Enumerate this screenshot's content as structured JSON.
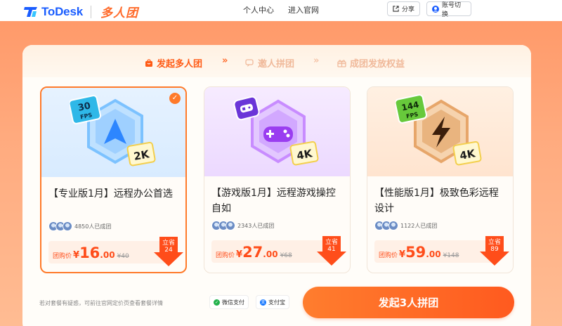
{
  "header": {
    "brand": "ToDesk",
    "sub_brand": "多人团",
    "nav": {
      "personal": "个人中心",
      "official": "进入官网"
    },
    "share": "分享",
    "switch_account": "账号切换"
  },
  "steps": [
    {
      "label": "发起多人团",
      "active": true,
      "icon": "bag-icon"
    },
    {
      "label": "邀人拼团",
      "active": false,
      "icon": "chat-icon"
    },
    {
      "label": "成团发放权益",
      "active": false,
      "icon": "gift-icon"
    }
  ],
  "step_separator": "»",
  "cards": [
    {
      "title": "【专业版1月】远程办公首选",
      "badge_top": "30 FPS",
      "badge_top_num": "30",
      "badge_top_unit": "FPS",
      "badge_res": "2K",
      "joined": "4850人已成团",
      "price_label": "团购价",
      "yen": "¥",
      "price_int": "16",
      "price_dec": ".00",
      "orig": "¥40",
      "save_label": "立省",
      "save_amount": "24",
      "selected": true,
      "theme": "#3c8dff"
    },
    {
      "title": "【游戏版1月】远程游戏操控自如",
      "badge_res": "4K",
      "joined": "2343人已成团",
      "price_label": "团购价",
      "yen": "¥",
      "price_int": "27",
      "price_dec": ".00",
      "orig": "¥68",
      "save_label": "立省",
      "save_amount": "41",
      "selected": false,
      "theme": "#a24cf0"
    },
    {
      "title": "【性能版1月】极致色彩远程设计",
      "badge_top_num": "144",
      "badge_top_unit": "FPS",
      "badge_res": "4K",
      "joined": "1122人已成团",
      "price_label": "团购价",
      "yen": "¥",
      "price_int": "59",
      "price_dec": ".00",
      "orig": "¥148",
      "save_label": "立省",
      "save_amount": "89",
      "selected": false,
      "theme": "#e88a3a"
    }
  ],
  "footer": {
    "faq": "若对套餐有疑惑，可前往官网定价页查看套餐详情",
    "pay_wechat": "微信支付",
    "pay_alipay": "支付宝",
    "cta": "发起3人拼团"
  },
  "colors": {
    "accent": "#ff5a14",
    "band": "#ff9a6a"
  }
}
